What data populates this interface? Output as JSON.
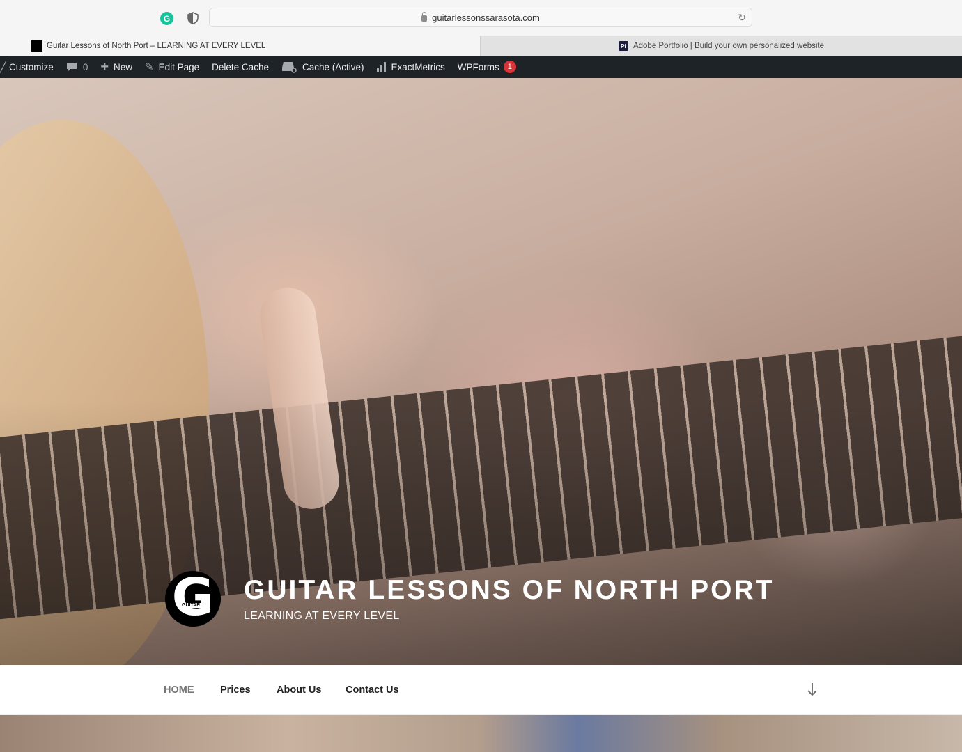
{
  "browser": {
    "url": "guitarlessonssarasota.com",
    "tabs": [
      {
        "title": "Guitar Lessons of North Port – LEARNING AT EVERY LEVEL"
      },
      {
        "title": "Adobe Portfolio | Build your own personalized website",
        "favicon_text": "Pf"
      }
    ],
    "extension_icon": "G"
  },
  "adminbar": {
    "customize": "Customize",
    "comments_count": "0",
    "new": "New",
    "edit_page": "Edit Page",
    "delete_cache": "Delete Cache",
    "cache": "Cache (Active)",
    "exactmetrics": "ExactMetrics",
    "wpforms": "WPForms",
    "wpforms_badge": "1"
  },
  "site": {
    "title": "GUITAR LESSONS OF NORTH PORT",
    "description": "LEARNING AT EVERY LEVEL",
    "logo_letter": "G",
    "logo_text": "GUITAR"
  },
  "nav": {
    "items": [
      "HOME",
      "Prices",
      "About Us",
      "Contact Us"
    ]
  },
  "colors": {
    "adminbar_bg": "#1d2327",
    "badge_red": "#d63638"
  }
}
